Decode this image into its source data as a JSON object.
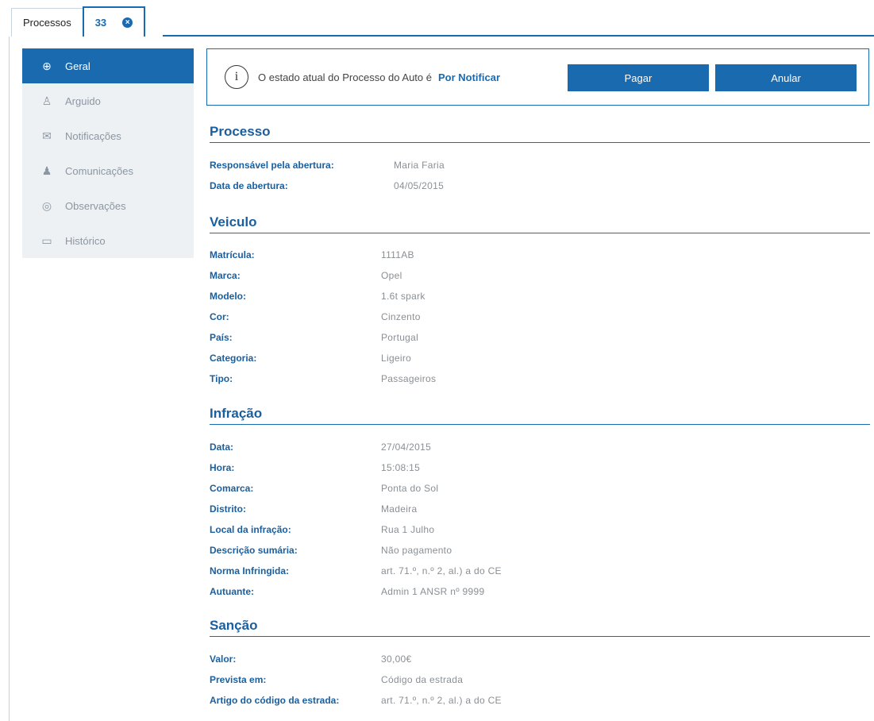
{
  "tabs": {
    "first_label": "Processos",
    "active_label": "33",
    "close_glyph": "×"
  },
  "sidebar": {
    "items": [
      {
        "label": "Geral",
        "icon": "globe-icon",
        "glyph": "⊕",
        "active": true
      },
      {
        "label": "Arguido",
        "icon": "user-icon",
        "glyph": "♙",
        "active": false
      },
      {
        "label": "Notificações",
        "icon": "mail-icon",
        "glyph": "✉",
        "active": false
      },
      {
        "label": "Comunicações",
        "icon": "users-icon",
        "glyph": "♟",
        "active": false
      },
      {
        "label": "Observações",
        "icon": "eye-icon",
        "glyph": "◎",
        "active": false
      },
      {
        "label": "Histórico",
        "icon": "folder-icon",
        "glyph": "▭",
        "active": false
      }
    ]
  },
  "status": {
    "info_glyph": "i",
    "text": "O estado atual do Processo do Auto é",
    "state": "Por Notificar",
    "pay_label": "Pagar",
    "cancel_label": "Anular"
  },
  "processo": {
    "title": "Processo",
    "rows": [
      {
        "label": "Responsável pela abertura:",
        "value": "Maria Faria"
      },
      {
        "label": "Data de abertura:",
        "value": "04/05/2015"
      }
    ]
  },
  "veiculo": {
    "title": "Veiculo",
    "rows": [
      {
        "label": "Matrícula:",
        "value": "1111AB"
      },
      {
        "label": "Marca:",
        "value": "Opel"
      },
      {
        "label": "Modelo:",
        "value": "1.6t spark"
      },
      {
        "label": "Cor:",
        "value": "Cinzento"
      },
      {
        "label": "País:",
        "value": "Portugal"
      },
      {
        "label": "Categoria:",
        "value": "Ligeiro"
      },
      {
        "label": "Tipo:",
        "value": "Passageiros"
      }
    ]
  },
  "infracao": {
    "title": "Infração",
    "rows": [
      {
        "label": "Data:",
        "value": "27/04/2015"
      },
      {
        "label": "Hora:",
        "value": "15:08:15"
      },
      {
        "label": "Comarca:",
        "value": "Ponta do Sol"
      },
      {
        "label": "Distrito:",
        "value": "Madeira"
      },
      {
        "label": "Local da infração:",
        "value": "Rua 1 Julho"
      },
      {
        "label": "Descrição sumária:",
        "value": "Não pagamento"
      },
      {
        "label": "Norma Infringida:",
        "value": "art. 71.º, n.º 2, al.) a do CE"
      },
      {
        "label": "Autuante:",
        "value": "Admin 1 ANSR nº 9999"
      }
    ]
  },
  "sancao": {
    "title": "Sanção",
    "rows": [
      {
        "label": "Valor:",
        "value": "30,00€"
      },
      {
        "label": "Prevista em:",
        "value": "Código da estrada"
      },
      {
        "label": "Artigo do código da estrada:",
        "value": "art. 71.º, n.º 2, al.) a do CE"
      }
    ]
  }
}
